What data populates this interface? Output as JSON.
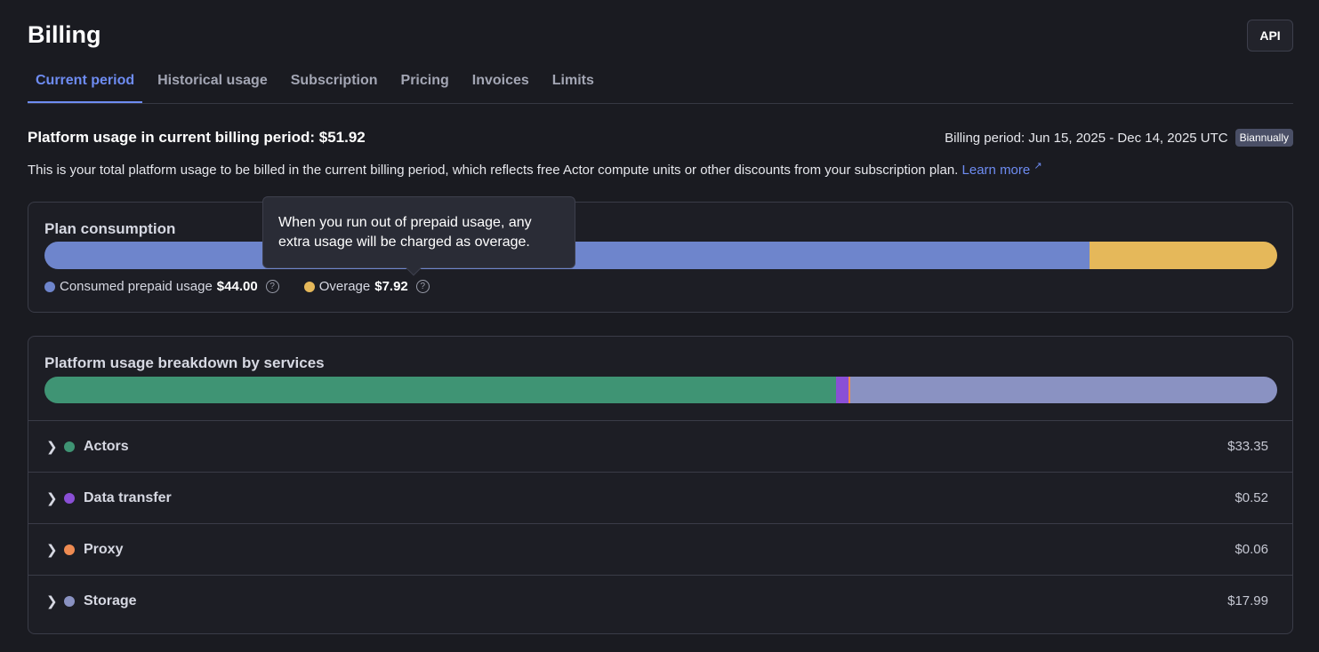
{
  "page": {
    "title": "Billing"
  },
  "header": {
    "api_label": "API"
  },
  "tabs": [
    {
      "label": "Current period",
      "active": true
    },
    {
      "label": "Historical usage",
      "active": false
    },
    {
      "label": "Subscription",
      "active": false
    },
    {
      "label": "Pricing",
      "active": false
    },
    {
      "label": "Invoices",
      "active": false
    },
    {
      "label": "Limits",
      "active": false
    }
  ],
  "usage": {
    "heading": "Platform usage in current billing period: $51.92",
    "billing_period": "Billing period: Jun 15, 2025 - Dec 14, 2025 UTC",
    "period_badge": "Biannually",
    "description": "This is your total platform usage to be billed in the current billing period, which reflects free Actor compute units or other discounts from your subscription plan.",
    "learn_more": "Learn more"
  },
  "plan": {
    "title": "Plan consumption",
    "consumed_label": "Consumed prepaid usage",
    "consumed_value": "$44.00",
    "overage_label": "Overage",
    "overage_value": "$7.92",
    "consumed_fraction": 0.8475,
    "overage_fraction": 0.1525,
    "colors": {
      "consumed": "#6e85cc",
      "overage": "#e5b85a"
    },
    "tooltip": "When you run out of prepaid usage, any extra usage will be charged as overage."
  },
  "breakdown": {
    "title": "Platform usage breakdown by services",
    "services": [
      {
        "name": "Actors",
        "amount": "$33.35",
        "value": 33.35,
        "color": "#3f9474"
      },
      {
        "name": "Data transfer",
        "amount": "$0.52",
        "value": 0.52,
        "color": "#8a4fd6"
      },
      {
        "name": "Proxy",
        "amount": "$0.06",
        "value": 0.06,
        "color": "#ee8b52"
      },
      {
        "name": "Storage",
        "amount": "$17.99",
        "value": 17.99,
        "color": "#8a92c2"
      }
    ]
  }
}
